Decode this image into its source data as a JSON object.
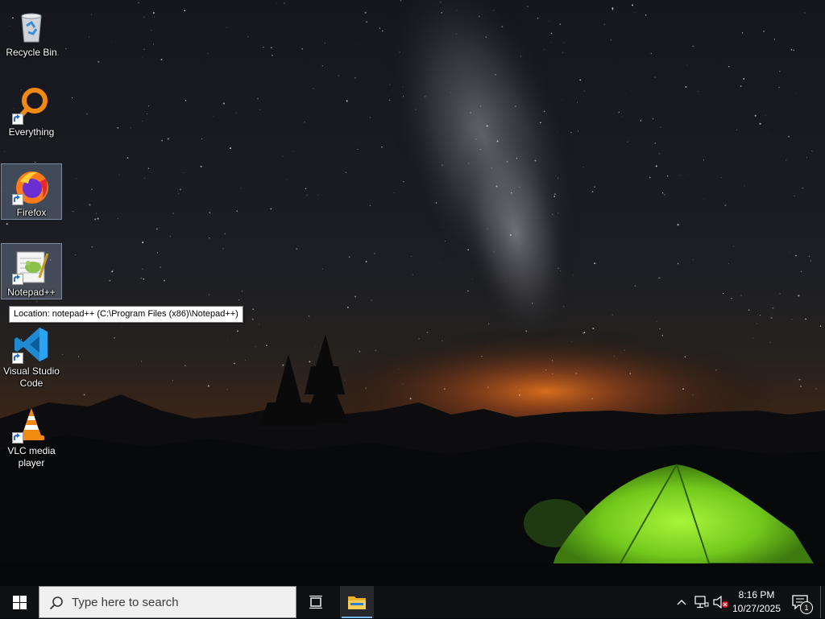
{
  "desktop": {
    "icons": [
      {
        "label": "Recycle Bin",
        "icon": "recycle-bin-icon",
        "shortcut": false,
        "selected": false
      },
      {
        "label": "Everything",
        "icon": "everything-search-icon",
        "shortcut": true,
        "selected": false
      },
      {
        "label": "Firefox",
        "icon": "firefox-icon",
        "shortcut": true,
        "selected": true
      },
      {
        "label": "Notepad++",
        "icon": "notepad-plus-plus-icon",
        "shortcut": true,
        "selected": true
      },
      {
        "label": "Visual Studio Code",
        "icon": "vscode-icon",
        "shortcut": true,
        "selected": false
      },
      {
        "label": "VLC media player",
        "icon": "vlc-icon",
        "shortcut": true,
        "selected": false
      }
    ],
    "tooltip": "Location: notepad++ (C:\\Program Files (x86)\\Notepad++)"
  },
  "taskbar": {
    "search_placeholder": "Type here to search",
    "pinned": [
      {
        "name": "Task View",
        "icon": "task-view-icon"
      },
      {
        "name": "File Explorer",
        "icon": "file-explorer-icon",
        "active": true
      }
    ],
    "tray": {
      "icons": [
        "chevron-up-icon",
        "network-icon",
        "volume-muted-icon"
      ],
      "time": "8:16 PM",
      "date": "10/27/2025",
      "notification_count": "1"
    }
  },
  "colors": {
    "taskbar": "#0f1012",
    "accent": "#76b9ed",
    "tent_green": "#7ad01e",
    "horizon_orange": "#d96a1a"
  }
}
